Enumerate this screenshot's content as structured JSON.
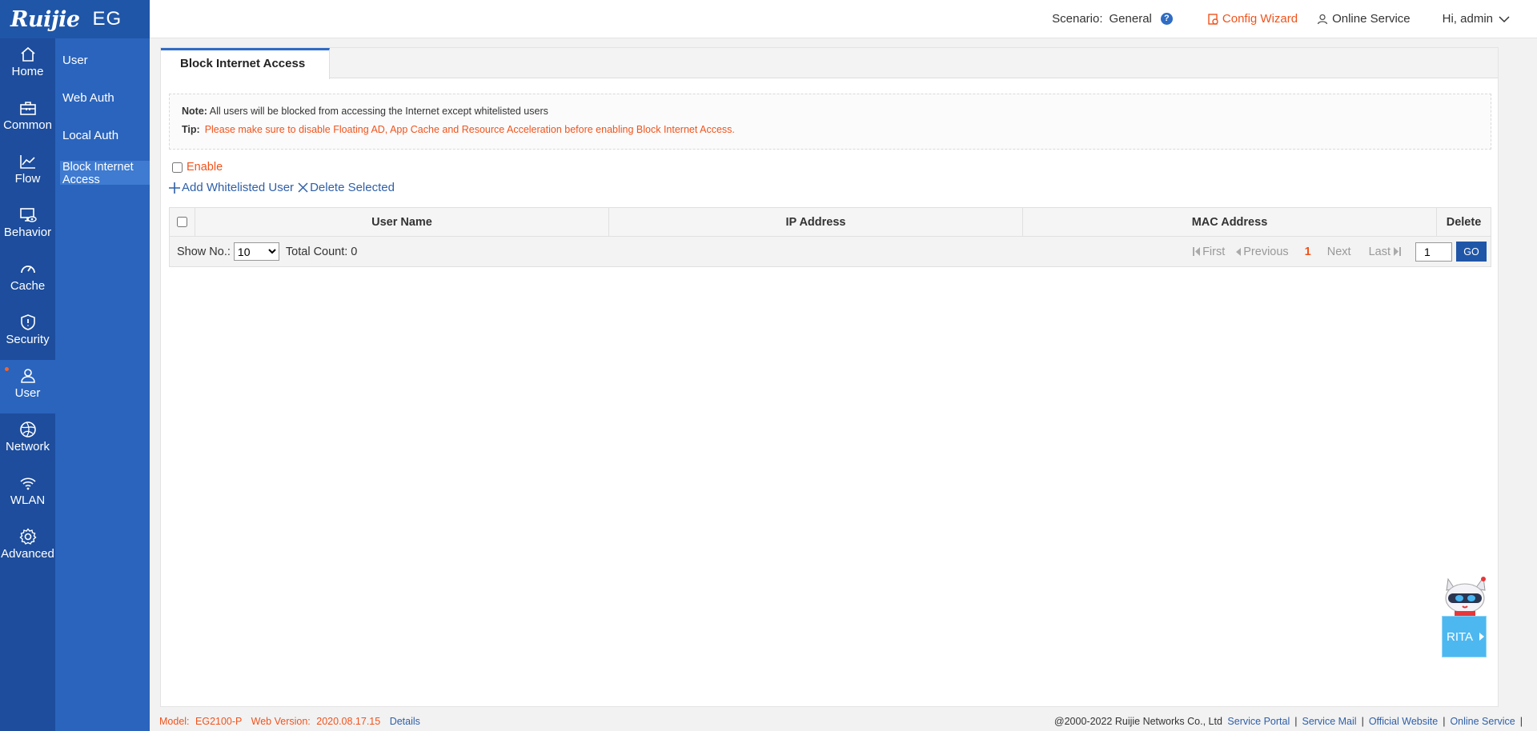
{
  "brand": {
    "logo": "Ruijie",
    "product": "EG"
  },
  "rail": [
    {
      "label": "Home",
      "icon": "home-icon"
    },
    {
      "label": "Common",
      "icon": "toolbox-icon"
    },
    {
      "label": "Flow",
      "icon": "line-chart-icon"
    },
    {
      "label": "Behavior",
      "icon": "monitor-eye-icon"
    },
    {
      "label": "Cache",
      "icon": "speedometer-icon"
    },
    {
      "label": "Security",
      "icon": "shield-icon"
    },
    {
      "label": "User",
      "icon": "user-icon",
      "active": true
    },
    {
      "label": "Network",
      "icon": "globe-icon"
    },
    {
      "label": "WLAN",
      "icon": "wifi-icon"
    },
    {
      "label": "Advanced",
      "icon": "gear-icon"
    }
  ],
  "submenu": [
    {
      "label": "User"
    },
    {
      "label": "Web Auth"
    },
    {
      "label": "Local Auth"
    },
    {
      "label": "Block Internet Access",
      "active": true
    }
  ],
  "topbar": {
    "scenario_label": "Scenario:",
    "scenario_value": "General",
    "help": "?",
    "config_wizard": "Config Wizard",
    "online_service": "Online Service",
    "greeting": "Hi, admin"
  },
  "tab": {
    "label": "Block Internet Access"
  },
  "notes": {
    "note_label": "Note:",
    "note_text": "All users will be blocked from accessing the Internet except whitelisted users",
    "tip_label": "Tip:",
    "tip_text": "Please make sure to disable Floating AD, App Cache and Resource Acceleration before enabling Block Internet Access."
  },
  "enable_label": "Enable",
  "actions": {
    "add": "Add Whitelisted User",
    "delete": "Delete Selected"
  },
  "table": {
    "columns": [
      "User Name",
      "IP Address",
      "MAC Address",
      "Delete"
    ],
    "rows": []
  },
  "pagination": {
    "show_label": "Show No.:",
    "page_size": "10",
    "total_label": "Total Count:",
    "total": "0",
    "first": "First",
    "previous": "Previous",
    "current": "1",
    "next": "Next",
    "last": "Last",
    "goto_value": "1",
    "go": "GO"
  },
  "assistant": {
    "label": "RITA"
  },
  "footer": {
    "model_label": "Model:",
    "model": "EG2100-P",
    "version_label": "Web Version:",
    "version": "2020.08.17.15",
    "details": "Details",
    "copyright": "@2000-2022 Ruijie Networks Co., Ltd",
    "links": [
      "Service Portal",
      "Service Mail",
      "Official Website",
      "Online Service"
    ]
  },
  "colors": {
    "rail": "#1d4d9c",
    "submenu": "#2a64bd",
    "accent": "#f0531c",
    "link": "#2f5fa8"
  }
}
